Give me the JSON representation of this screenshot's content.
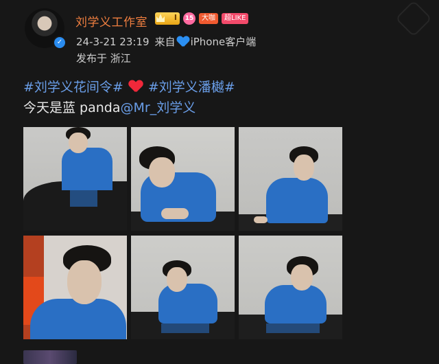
{
  "post": {
    "author": "刘学义工作室",
    "badges": {
      "level": "I",
      "fans_level": "15",
      "v_label": "大咖",
      "like_label": "超LIKE"
    },
    "timestamp": "24-3-21 23:19",
    "source_prefix": "来自",
    "source_device": "iPhone客户端",
    "location": "发布于 浙江",
    "hashtag1": "#刘学义花间令#",
    "hashtag2": "#刘学义潘樾#",
    "text": "今天是蓝 panda",
    "mention": "@Mr_刘学义",
    "photos": [
      {
        "alt": "photo-1"
      },
      {
        "alt": "photo-2"
      },
      {
        "alt": "photo-3"
      },
      {
        "alt": "photo-4"
      },
      {
        "alt": "photo-5"
      },
      {
        "alt": "photo-6"
      }
    ]
  },
  "icons": {
    "verified": "verified-icon",
    "heart_red": "red-heart-emoji",
    "heart_blue": "blue-heart-emoji"
  },
  "colors": {
    "username": "#f07f40",
    "link": "#6a9ee8",
    "background": "#171717"
  }
}
